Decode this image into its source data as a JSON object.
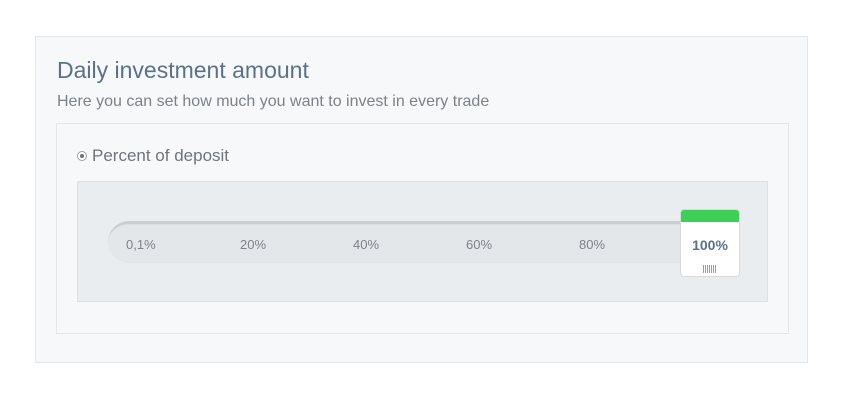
{
  "section": {
    "title": "Daily investment amount",
    "subtitle": "Here you can set how much you want to invest in every trade"
  },
  "option": {
    "label": "Percent of deposit",
    "selected": true
  },
  "slider": {
    "ticks": [
      "0,1%",
      "20%",
      "40%",
      "60%",
      "80%"
    ],
    "value_label": "100%",
    "value_percent": 100,
    "accent_color": "#3ecf56",
    "handle_icon": "grip-lines-icon"
  }
}
